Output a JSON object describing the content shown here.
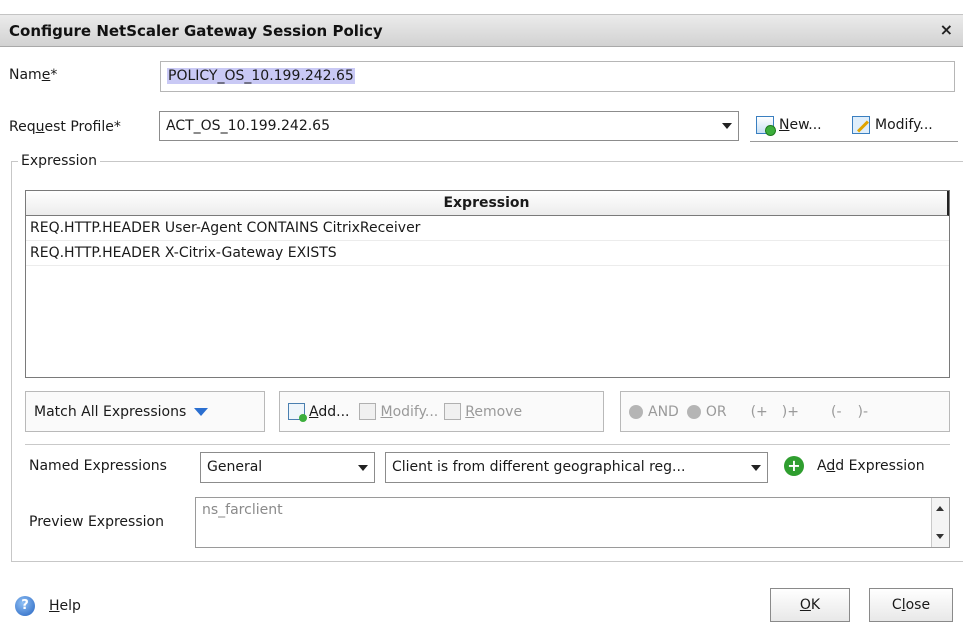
{
  "dialog": {
    "title": "Configure NetScaler Gateway Session Policy",
    "close_glyph": "×"
  },
  "name": {
    "label_pre": "Nam",
    "label_accel": "e",
    "label_post": "*",
    "value": "POLICY_OS_10.199.242.65"
  },
  "request_profile": {
    "label_pre": "Req",
    "label_accel": "u",
    "label_post": "est Profile*",
    "value": "ACT_OS_10.199.242.65",
    "new_accel": "N",
    "new_rest": "ew...",
    "modify_label": "Modify..."
  },
  "expression_group": {
    "legend": "Expression",
    "table_header": "Expression",
    "rows": [
      "REQ.HTTP.HEADER User-Agent CONTAINS CitrixReceiver",
      "REQ.HTTP.HEADER X-Citrix-Gateway EXISTS"
    ]
  },
  "toolbar": {
    "match_label": "Match All Expressions",
    "add_accel": "A",
    "add_rest": "dd...",
    "modify_accel": "M",
    "modify_rest": "odify...",
    "remove_accel": "R",
    "remove_rest": "emove",
    "and_label": "AND",
    "or_label": "OR",
    "paren_open": "(+",
    "paren_close": ")+",
    "neg_open": "(-",
    "neg_close": ")-"
  },
  "named_expressions": {
    "label": "Named Expressions",
    "category": "General",
    "expression": "Client is from different geographical reg...",
    "add_pre": "A",
    "add_accel": "d",
    "add_post": "d Expression"
  },
  "preview": {
    "label": "Preview Expression",
    "value": "ns_farclient"
  },
  "footer": {
    "help_accel": "H",
    "help_rest": "elp",
    "ok_accel": "O",
    "ok_rest": "K",
    "close_pre": "C",
    "close_accel": "l",
    "close_post": "ose"
  },
  "colors": {
    "titlebar": "#d9d9d9",
    "selection": "#c9c9f5",
    "accent_blue": "#2b6fd0",
    "add_green": "#2f9e2f"
  }
}
